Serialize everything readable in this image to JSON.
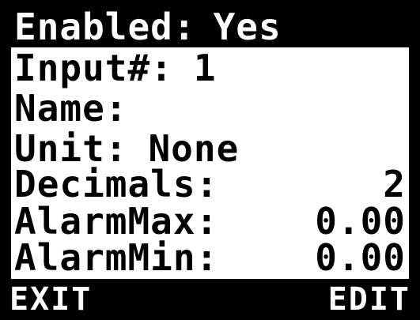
{
  "menu": {
    "enabled": {
      "label": "Enabled:",
      "value": "Yes"
    },
    "input_number": {
      "label": "Input#:",
      "value": "1"
    },
    "name": {
      "label": "Name:",
      "value": ""
    },
    "unit": {
      "label": "Unit:",
      "value": "None"
    },
    "decimals": {
      "label": "Decimals:",
      "value": "2"
    },
    "alarm_max": {
      "label": "AlarmMax:",
      "value": "0.00"
    },
    "alarm_min": {
      "label": "AlarmMin:",
      "value": "0.00"
    }
  },
  "softkeys": {
    "left_label": "EXIT",
    "right_label": "EDIT"
  },
  "colors": {
    "background": "#ffffff",
    "foreground": "#000000",
    "highlight_bg": "#000000",
    "highlight_fg": "#ffffff"
  }
}
